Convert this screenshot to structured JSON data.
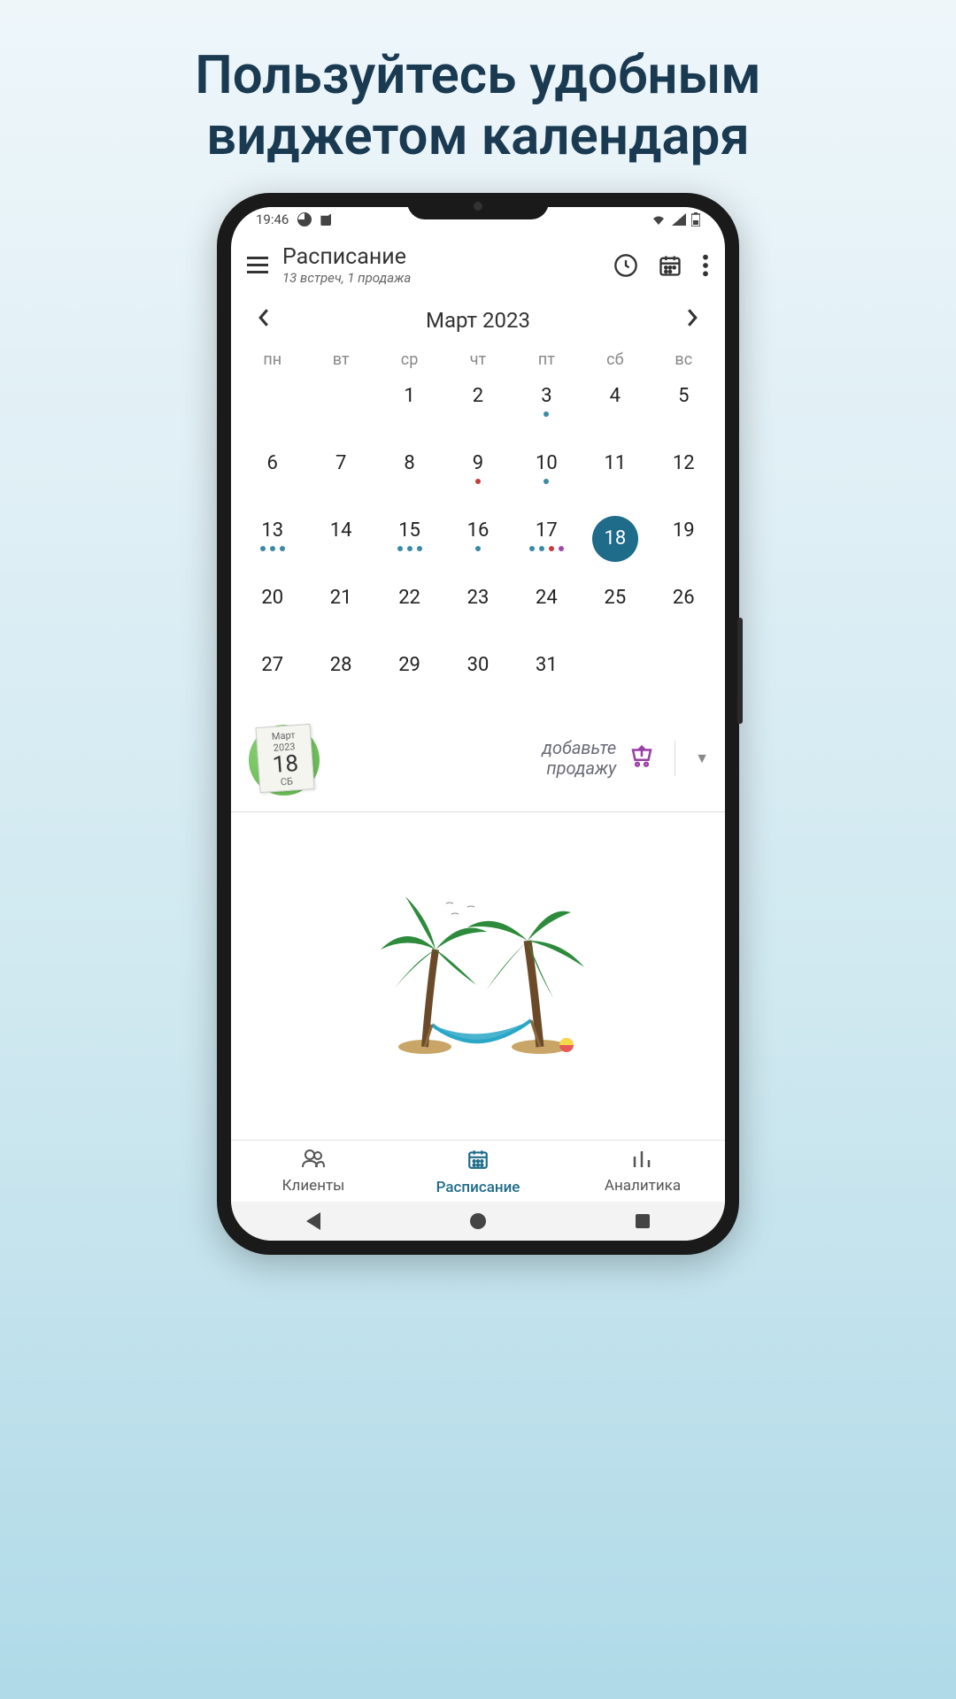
{
  "promo": {
    "line1": "Пользуйтесь удобным",
    "line2": "виджетом календаря"
  },
  "status": {
    "time": "19:46"
  },
  "header": {
    "title": "Расписание",
    "subtitle": "13 встреч, 1 продажа"
  },
  "month": {
    "label": "Март 2023"
  },
  "weekdays": [
    "пн",
    "вт",
    "ср",
    "чт",
    "пт",
    "сб",
    "вс"
  ],
  "calendar": {
    "rows": [
      [
        {
          "n": ""
        },
        {
          "n": ""
        },
        {
          "n": "1"
        },
        {
          "n": "2"
        },
        {
          "n": "3",
          "dots": [
            "teal"
          ]
        },
        {
          "n": "4"
        },
        {
          "n": "5"
        }
      ],
      [
        {
          "n": "6"
        },
        {
          "n": "7"
        },
        {
          "n": "8"
        },
        {
          "n": "9",
          "dots": [
            "red"
          ]
        },
        {
          "n": "10",
          "dots": [
            "teal"
          ]
        },
        {
          "n": "11"
        },
        {
          "n": "12"
        }
      ],
      [
        {
          "n": "13",
          "dots": [
            "teal",
            "teal",
            "teal"
          ]
        },
        {
          "n": "14"
        },
        {
          "n": "15",
          "dots": [
            "teal",
            "teal",
            "teal"
          ]
        },
        {
          "n": "16",
          "dots": [
            "teal"
          ]
        },
        {
          "n": "17",
          "dots": [
            "teal",
            "teal",
            "red",
            "purple"
          ]
        },
        {
          "n": "18",
          "selected": true
        },
        {
          "n": "19"
        }
      ],
      [
        {
          "n": "20"
        },
        {
          "n": "21"
        },
        {
          "n": "22"
        },
        {
          "n": "23"
        },
        {
          "n": "24"
        },
        {
          "n": "25"
        },
        {
          "n": "26"
        }
      ],
      [
        {
          "n": "27"
        },
        {
          "n": "28"
        },
        {
          "n": "29"
        },
        {
          "n": "30"
        },
        {
          "n": "31"
        },
        {
          "n": ""
        },
        {
          "n": ""
        }
      ]
    ]
  },
  "tearoff": {
    "month": "Март",
    "year": "2023",
    "day": "18",
    "wd": "СБ"
  },
  "actions": {
    "add_sale_line1": "добавьте",
    "add_sale_line2": "продажу"
  },
  "bottomnav": {
    "clients": "Клиенты",
    "schedule": "Расписание",
    "analytics": "Аналитика"
  }
}
